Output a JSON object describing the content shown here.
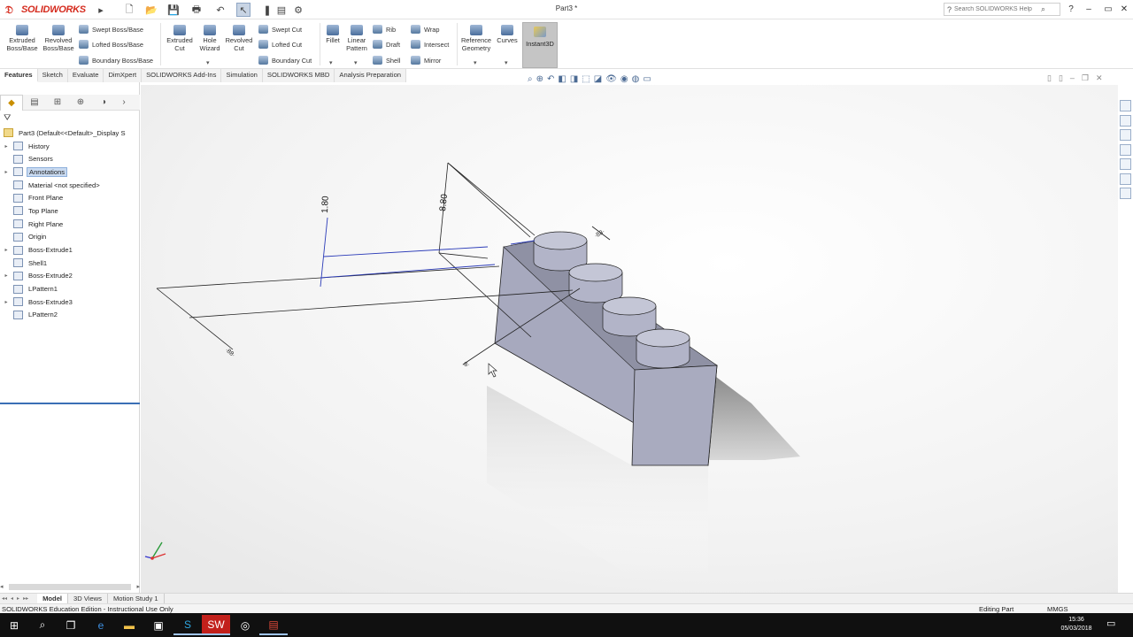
{
  "app": {
    "logo_text": "SOLIDWORKS",
    "document_title": "Part3 *",
    "search_placeholder": "Search SOLIDWORKS Help",
    "help_icon": "question-icon",
    "window_controls": [
      "minimize-icon",
      "restore-icon",
      "close-icon"
    ]
  },
  "quick_access": [
    "new-icon",
    "open-icon",
    "save-icon",
    "print-icon",
    "undo-icon",
    "select-icon",
    "rebuild-icon",
    "file-properties-icon",
    "options-icon"
  ],
  "ribbon": {
    "extruded_boss": "Extruded Boss/Base",
    "revolved_boss": "Revolved Boss/Base",
    "swept_boss": "Swept Boss/Base",
    "lofted_boss": "Lofted Boss/Base",
    "boundary_boss": "Boundary Boss/Base",
    "extruded_cut": "Extruded Cut",
    "hole_wizard": "Hole Wizard",
    "revolved_cut": "Revolved Cut",
    "swept_cut": "Swept Cut",
    "lofted_cut": "Lofted Cut",
    "boundary_cut": "Boundary Cut",
    "fillet": "Fillet",
    "linear_pattern": "Linear Pattern",
    "rib": "Rib",
    "draft": "Draft",
    "shell": "Shell",
    "wrap": "Wrap",
    "intersect": "Intersect",
    "mirror": "Mirror",
    "reference_geometry": "Reference Geometry",
    "curves": "Curves",
    "instant3d": "Instant3D"
  },
  "command_tabs": [
    "Features",
    "Sketch",
    "Evaluate",
    "DimXpert",
    "SOLIDWORKS Add-Ins",
    "Simulation",
    "SOLIDWORKS MBD",
    "Analysis Preparation"
  ],
  "active_command_tab": "Features",
  "feature_tree": {
    "root": "Part3  (Default<<Default>_Display S",
    "items": [
      {
        "label": "History",
        "icon": "history-folder-icon",
        "expandable": true
      },
      {
        "label": "Sensors",
        "icon": "sensors-icon",
        "expandable": false
      },
      {
        "label": "Annotations",
        "icon": "annotations-icon",
        "expandable": true,
        "selected": true
      },
      {
        "label": "Material <not specified>",
        "icon": "material-icon",
        "expandable": false
      },
      {
        "label": "Front Plane",
        "icon": "plane-icon",
        "expandable": false
      },
      {
        "label": "Top Plane",
        "icon": "plane-icon",
        "expandable": false
      },
      {
        "label": "Right Plane",
        "icon": "plane-icon",
        "expandable": false
      },
      {
        "label": "Origin",
        "icon": "origin-icon",
        "expandable": false
      },
      {
        "label": "Boss-Extrude1",
        "icon": "boss-extrude-icon",
        "expandable": true
      },
      {
        "label": "Shell1",
        "icon": "shell-icon",
        "expandable": false
      },
      {
        "label": "Boss-Extrude2",
        "icon": "boss-extrude-icon",
        "expandable": true
      },
      {
        "label": "LPattern1",
        "icon": "linear-pattern-icon",
        "expandable": false
      },
      {
        "label": "Boss-Extrude3",
        "icon": "boss-extrude-icon",
        "expandable": true
      },
      {
        "label": "LPattern2",
        "icon": "linear-pattern-icon",
        "expandable": false
      }
    ]
  },
  "viewport": {
    "dimensions": [
      "1.80",
      "8.80"
    ]
  },
  "bottom_tabs": [
    "Model",
    "3D Views",
    "Motion Study 1"
  ],
  "active_bottom_tab": "Model",
  "status": {
    "left": "SOLIDWORKS Education Edition - Instructional Use Only",
    "mode": "Editing Part",
    "units": "MMGS"
  },
  "taskbar": {
    "time": "15:36",
    "date": "05/03/2018"
  },
  "colors": {
    "accent_red": "#d52b1e",
    "selection_blue": "#c9daf0",
    "part_face": "#a9abc0"
  }
}
